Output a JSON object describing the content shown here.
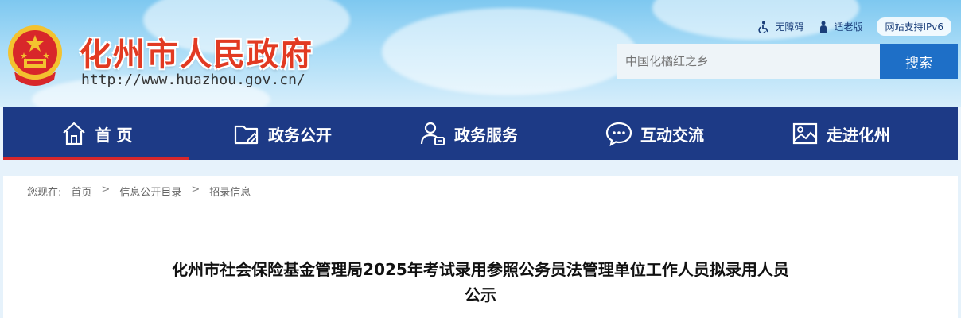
{
  "header": {
    "site_name": "化州市人民政府",
    "site_url": "http://www.huazhou.gov.cn/",
    "top_links": {
      "accessibility": "无障碍",
      "elderly": "适老版",
      "ipv6": "网站支持IPv6"
    },
    "search": {
      "placeholder": "中国化橘红之乡",
      "button_label": "搜索"
    }
  },
  "nav": {
    "items": [
      {
        "label": "首 页",
        "icon": "home-icon",
        "active": true
      },
      {
        "label": "政务公开",
        "icon": "folder-edit-icon"
      },
      {
        "label": "政务服务",
        "icon": "user-service-icon"
      },
      {
        "label": "互动交流",
        "icon": "chat-bubble-icon"
      },
      {
        "label": "走进化州",
        "icon": "picture-icon"
      }
    ]
  },
  "breadcrumb": {
    "prefix": "您现在:",
    "items": [
      "首页",
      "信息公开目录",
      "招录信息"
    ],
    "separator": ">"
  },
  "article": {
    "title_line1": "化州市社会保险基金管理局2025年考试录用参照公务员法管理单位工作人员拟录用人员",
    "title_line2": "公示"
  },
  "colors": {
    "nav_bg": "#1d3a86",
    "nav_active": "#d8272a",
    "search_button": "#1e6fc7",
    "site_name": "#e23a22"
  }
}
